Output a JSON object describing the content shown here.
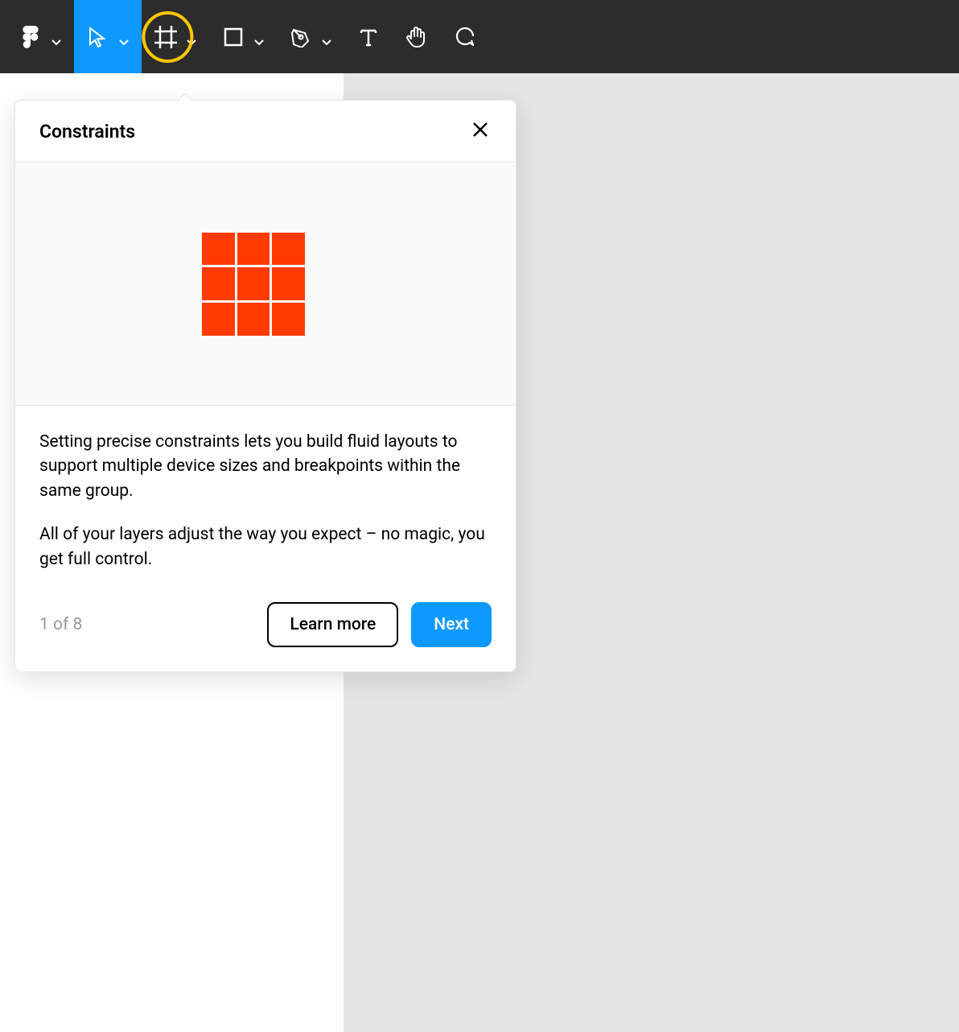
{
  "toolbar": {
    "items": [
      {
        "name": "figma-menu",
        "icon": "figma",
        "hasChevron": true
      },
      {
        "name": "move-tool",
        "icon": "cursor",
        "hasChevron": true,
        "active": true
      },
      {
        "name": "frame-tool",
        "icon": "frame",
        "hasChevron": true,
        "highlighted": true
      },
      {
        "name": "shape-tool",
        "icon": "rectangle",
        "hasChevron": true
      },
      {
        "name": "pen-tool",
        "icon": "pen",
        "hasChevron": true
      },
      {
        "name": "text-tool",
        "icon": "text",
        "hasChevron": false
      },
      {
        "name": "hand-tool",
        "icon": "hand",
        "hasChevron": false
      },
      {
        "name": "comment-tool",
        "icon": "comment",
        "hasChevron": false
      }
    ]
  },
  "tooltip": {
    "title": "Constraints",
    "paragraph1": "Setting precise constraints lets you build fluid layouts to support multiple device sizes and breakpoints within the same group.",
    "paragraph2": "All of your layers adjust the way you expect – no magic, you get full control.",
    "stepIndicator": "1 of 8",
    "learnMoreLabel": "Learn more",
    "nextLabel": "Next"
  }
}
